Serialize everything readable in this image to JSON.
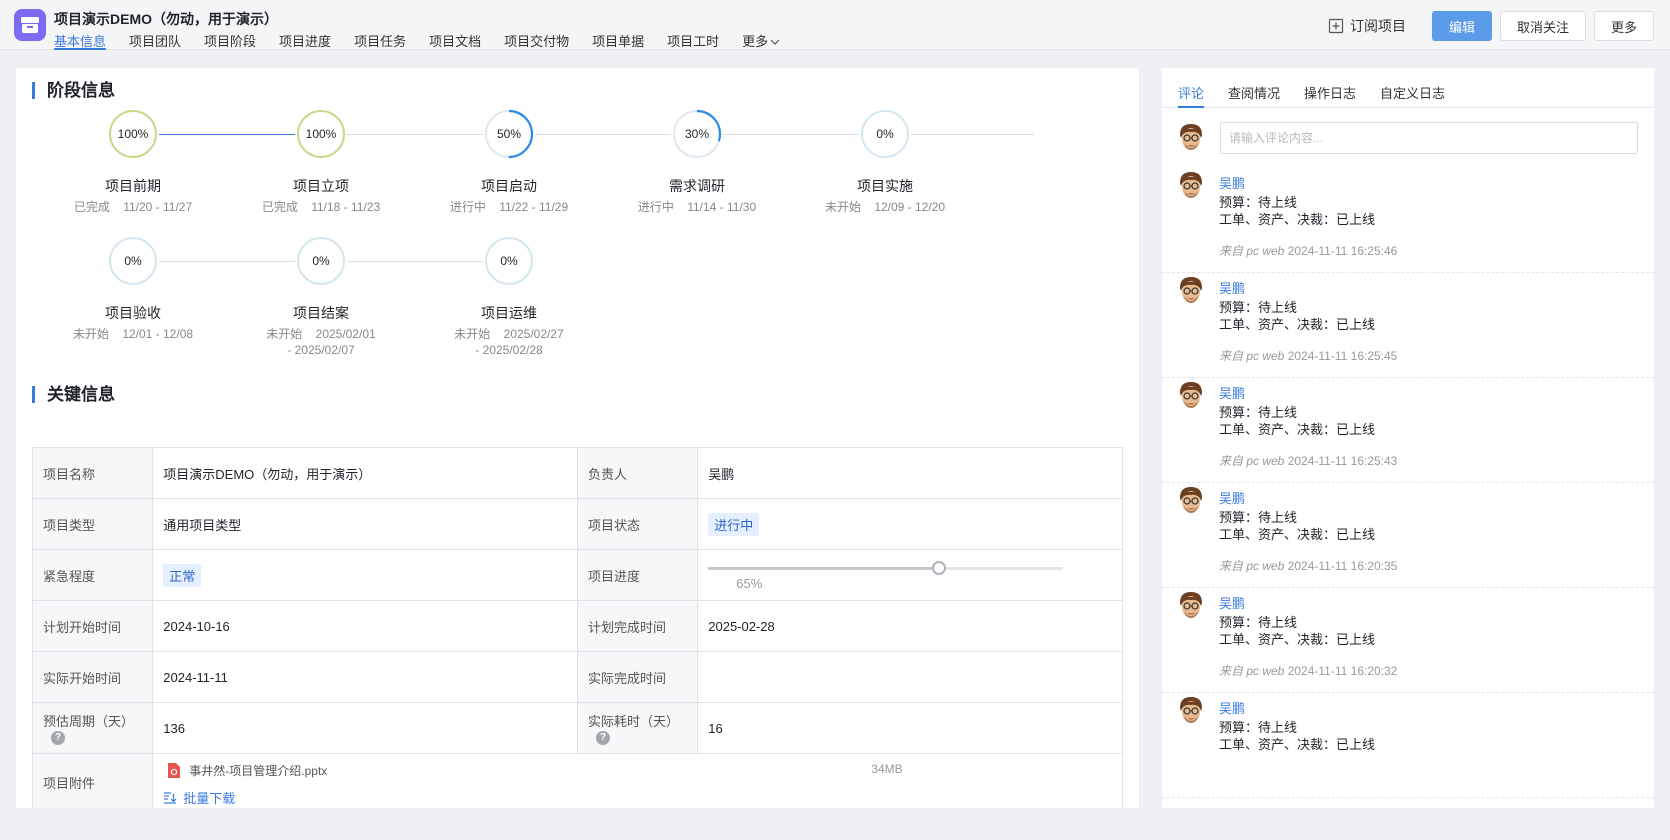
{
  "header": {
    "title": "项目演示DEMO（勿动，用于演示）",
    "tabs": [
      "基本信息",
      "项目团队",
      "项目阶段",
      "项目进度",
      "项目任务",
      "项目文档",
      "项目交付物",
      "项目单据",
      "项目工时",
      "更多"
    ],
    "subscribe_label": "订阅项目",
    "edit_label": "编辑",
    "unfollow_label": "取消关注",
    "more_label": "更多",
    "accent_color": "#3a7be0"
  },
  "stages_section": {
    "title": "阶段信息",
    "stages": [
      {
        "percent": "100%",
        "progress": 100,
        "name": "项目前期",
        "status": "已完成",
        "dates": "11/20 - 11/27"
      },
      {
        "percent": "100%",
        "progress": 100,
        "name": "项目立项",
        "status": "已完成",
        "dates": "11/18 - 11/23"
      },
      {
        "percent": "50%",
        "progress": 50,
        "name": "项目启动",
        "status": "进行中",
        "dates": "11/22 - 11/29"
      },
      {
        "percent": "30%",
        "progress": 30,
        "name": "需求调研",
        "status": "进行中",
        "dates": "11/14 - 11/30"
      },
      {
        "percent": "0%",
        "progress": 0,
        "name": "项目实施",
        "status": "未开始",
        "dates": "12/09 - 12/20"
      },
      {
        "percent": "0%",
        "progress": 0,
        "name": "项目验收",
        "status": "未开始",
        "dates": "12/01 - 12/08"
      },
      {
        "percent": "0%",
        "progress": 0,
        "name": "项目结案",
        "status": "未开始",
        "dates": "2025/02/01 - 2025/02/07"
      },
      {
        "percent": "0%",
        "progress": 0,
        "name": "项目运维",
        "status": "未开始",
        "dates": "2025/02/27 - 2025/02/28"
      }
    ]
  },
  "key_info": {
    "title": "关键信息",
    "project_name_label": "项目名称",
    "project_name": "项目演示DEMO（勿动，用于演示）",
    "owner_label": "负责人",
    "owner": "吴鹏",
    "type_label": "项目类型",
    "type": "通用项目类型",
    "status_label": "项目状态",
    "status": "进行中",
    "urgency_label": "紧急程度",
    "urgency": "正常",
    "progress_label": "项目进度",
    "progress_value": 65,
    "progress_text": "65%",
    "plan_start_label": "计划开始时间",
    "plan_start": "2024-10-16",
    "plan_end_label": "计划完成时间",
    "plan_end": "2025-02-28",
    "actual_start_label": "实际开始时间",
    "actual_start": "2024-11-11",
    "actual_end_label": "实际完成时间",
    "actual_end": "",
    "est_cycle_label": "预估周期（天）",
    "est_cycle": "136",
    "actual_cost_label": "实际耗时（天）",
    "actual_cost": "16",
    "attachment_label": "项目附件",
    "attachment_name": "事井然-项目管理介绍.pptx",
    "attachment_size": "34MB",
    "batch_download_label": "批量下载"
  },
  "sidebar": {
    "tabs": [
      "评论",
      "查阅情况",
      "操作日志",
      "自定义日志"
    ],
    "comment_placeholder": "请输入评论内容...",
    "comments": [
      {
        "user": "吴鹏",
        "line1": "预算：待上线",
        "line2": "工单、资产、决裁：已上线",
        "source": "来自 pc web",
        "time": "2024-11-11 16:25:46"
      },
      {
        "user": "吴鹏",
        "line1": "预算：待上线",
        "line2": "工单、资产、决裁：已上线",
        "source": "来自 pc web",
        "time": "2024-11-11 16:25:45"
      },
      {
        "user": "吴鹏",
        "line1": "预算：待上线",
        "line2": "工单、资产、决裁：已上线",
        "source": "来自 pc web",
        "time": "2024-11-11 16:25:43"
      },
      {
        "user": "吴鹏",
        "line1": "预算：待上线",
        "line2": "工单、资产、决裁：已上线",
        "source": "来自 pc web",
        "time": "2024-11-11 16:20:35"
      },
      {
        "user": "吴鹏",
        "line1": "预算：待上线",
        "line2": "工单、资产、决裁：已上线",
        "source": "来自 pc web",
        "time": "2024-11-11 16:20:32"
      },
      {
        "user": "吴鹏",
        "line1": "预算：待上线",
        "line2": "工单、资产、决裁：已上线",
        "source": "",
        "time": ""
      }
    ]
  }
}
